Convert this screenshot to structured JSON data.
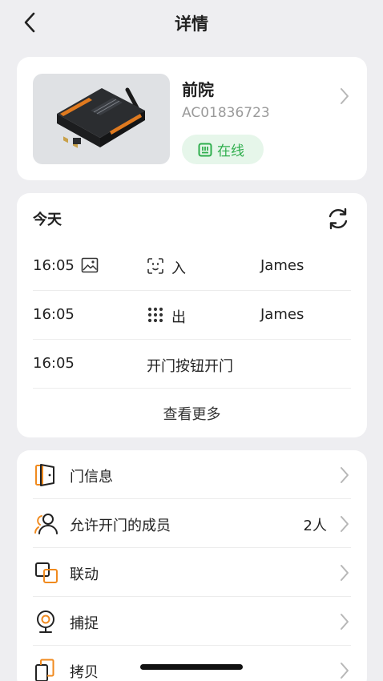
{
  "header": {
    "title": "详情",
    "back_icon": "chevron-left-icon"
  },
  "device": {
    "name": "前院",
    "id": "AC01836723",
    "status": "在线",
    "status_color": "#2fae4d"
  },
  "today": {
    "title": "今天",
    "refresh_icon": "refresh-icon",
    "events": [
      {
        "time": "16:05",
        "time_icon": "image-icon",
        "event_icon": "face-icon",
        "event": "入",
        "who": "James"
      },
      {
        "time": "16:05",
        "event_icon": "keypad-icon",
        "event": "出",
        "who": "James"
      },
      {
        "time": "16:05",
        "event": "开门按钮开门"
      }
    ],
    "more": "查看更多"
  },
  "menu": {
    "accent": "#f08a1e",
    "items": [
      {
        "label": "门信息",
        "icon": "door-icon"
      },
      {
        "label": "允许开门的成员",
        "value": "2人",
        "icon": "members-icon"
      },
      {
        "label": "联动",
        "icon": "linkage-icon"
      },
      {
        "label": "捕捉",
        "icon": "camera-icon"
      },
      {
        "label": "拷贝",
        "icon": "copy-icon"
      }
    ]
  }
}
